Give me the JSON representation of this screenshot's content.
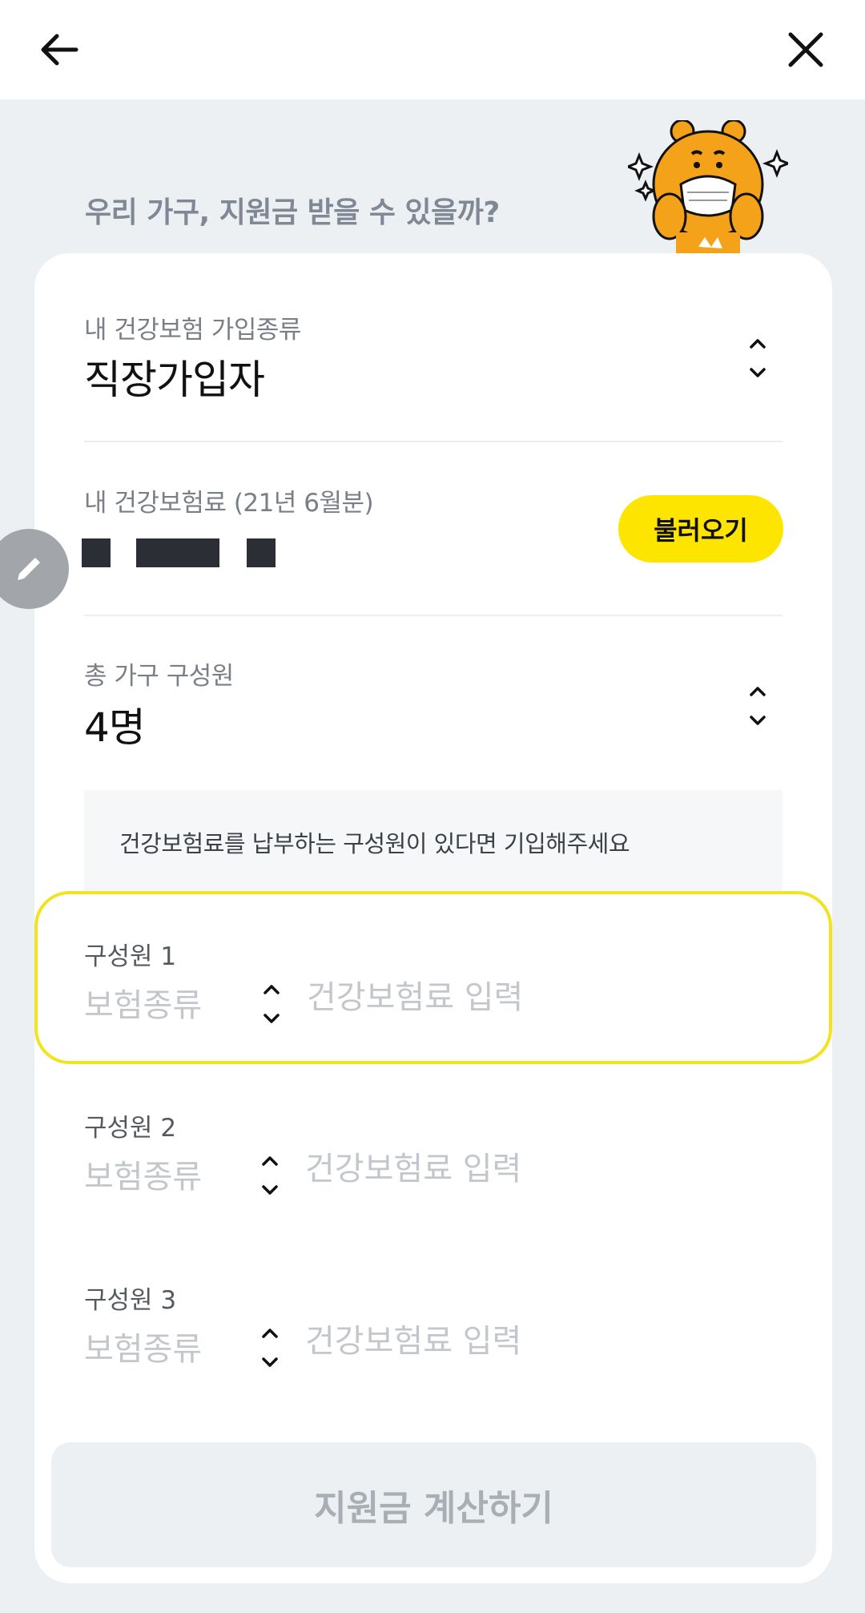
{
  "header": {
    "back_icon": "arrow-left-icon",
    "close_icon": "close-icon"
  },
  "headline": "우리 가구, 지원금 받을 수 있을까?",
  "mascot": "character-with-mask-sparkle",
  "form": {
    "insurance_type": {
      "label": "내 건강보험 가입종류",
      "value": "직장가입자"
    },
    "premium": {
      "label": "내 건강보험료 (21년 6월분)",
      "load_button": "불러오기"
    },
    "household": {
      "label": "총 가구 구성원",
      "value": "4명"
    },
    "notice": "건강보험료를 납부하는 구성원이 있다면 기입해주세요",
    "members": [
      {
        "label": "구성원 1",
        "type_placeholder": "보험종류",
        "input_placeholder": "건강보험료 입력"
      },
      {
        "label": "구성원 2",
        "type_placeholder": "보험종류",
        "input_placeholder": "건강보험료 입력"
      },
      {
        "label": "구성원 3",
        "type_placeholder": "보험종류",
        "input_placeholder": "건강보험료 입력"
      }
    ]
  },
  "submit_button": "지원금 계산하기",
  "colors": {
    "accent_yellow": "#fee500",
    "focus_border": "#f3e31f",
    "background": "#edf0f3"
  }
}
